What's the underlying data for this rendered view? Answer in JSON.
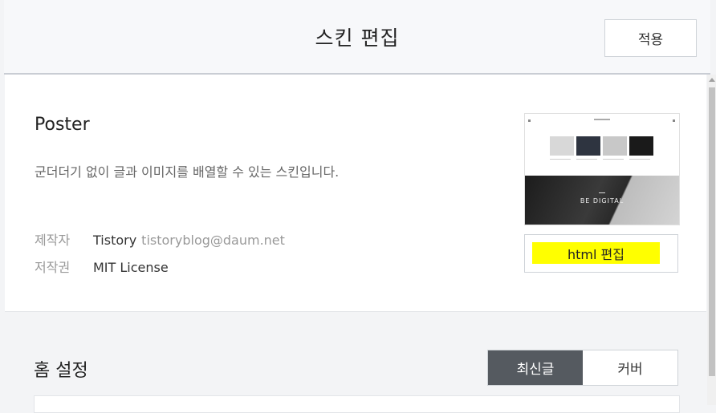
{
  "header": {
    "title": "스킨 편집",
    "apply_label": "적용"
  },
  "skin": {
    "name": "Poster",
    "description": "군더더기 없이 글과 이미지를 배열할 수 있는 스킨입니다.",
    "author_label": "제작자",
    "author_name": "Tistory",
    "author_email": "tistoryblog@daum.net",
    "license_label": "저작권",
    "license_value": "MIT License",
    "thumbnail_text": "BE DIGITAL",
    "html_edit_label": "html 편집"
  },
  "home": {
    "title": "홈 설정",
    "options": [
      {
        "label": "최신글",
        "selected": true
      },
      {
        "label": "커버",
        "selected": false
      }
    ]
  },
  "colors": {
    "highlight": "#ffff00",
    "toggle_active": "#555a60",
    "page_bg": "#f3f4f6"
  },
  "icons": [
    "scroll-up-arrow-icon"
  ]
}
